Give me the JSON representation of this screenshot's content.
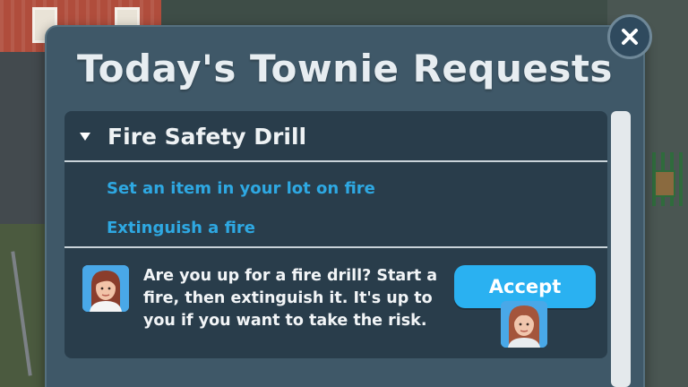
{
  "panel": {
    "title": "Today's Townie Requests",
    "close_icon": "close-icon"
  },
  "quest": {
    "title": "Fire Safety Drill",
    "expanded": true,
    "tasks": [
      "Set an item in your lot on fire",
      "Extinguish a fire"
    ],
    "request_text": "Are you up for a fire drill? Start a fire, then extinguish it. It's up to you if you want to take the risk.",
    "accept_label": "Accept"
  },
  "colors": {
    "panel_bg": "#3f5868",
    "list_bg": "#293d4b",
    "task_link": "#2ea8e2",
    "accept_bg": "#2ab1f1"
  }
}
